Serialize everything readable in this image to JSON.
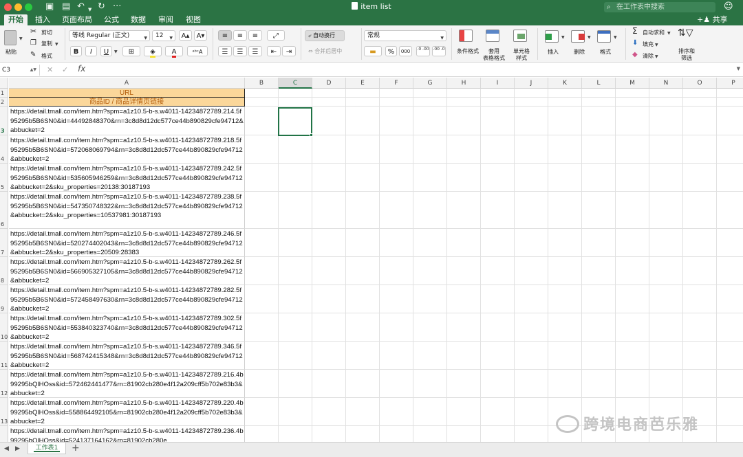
{
  "window": {
    "title": "item list",
    "search_placeholder": "在工作表中搜索"
  },
  "tabs": [
    "开始",
    "插入",
    "页面布局",
    "公式",
    "数据",
    "审阅",
    "视图"
  ],
  "share_label": "共享",
  "ribbon": {
    "paste": "粘贴",
    "cut": "剪切",
    "copy": "复制",
    "format_painter": "格式",
    "font_name": "等线 Regular (正文)",
    "font_size": "12",
    "bold": "B",
    "italic": "I",
    "underline": "U",
    "wrap_text": "自动换行",
    "merge_center": "合并后居中",
    "number_format": "常规",
    "percent": "%",
    "thousands": "000",
    "inc_decimal": ".0 .00",
    "dec_decimal": ".00 .0",
    "conditional_format": "条件格式",
    "table_format": "套用\n表格格式",
    "cell_style": "单元格\n样式",
    "insert": "插入",
    "delete": "删除",
    "format": "格式",
    "autosum": "自动求和",
    "fill": "填充",
    "clear": "清除",
    "sort_filter": "排序和\n筛选"
  },
  "formula_bar": {
    "name_box": "C3",
    "fx": "fx",
    "value": ""
  },
  "columns": [
    "A",
    "B",
    "C",
    "D",
    "E",
    "F",
    "G",
    "H",
    "I",
    "J",
    "K",
    "L",
    "M",
    "N",
    "O",
    "P"
  ],
  "selected_column": "C",
  "selected_row": "3",
  "rows": [
    {
      "num": "1",
      "text": "URL",
      "header": true
    },
    {
      "num": "2",
      "text": "商品ID / 商品详情页链接",
      "header": true
    },
    {
      "num": "3",
      "text": "https://detail.tmall.com/item.htm?spm=a1z10.5-b-s.w4011-14234872789.214.5f95295b5B6SN0&id=44492848370&rn=3c8d8d12dc577ce44b890829cfe94712&abbucket=2"
    },
    {
      "num": "4",
      "text": "https://detail.tmall.com/item.htm?spm=a1z10.5-b-s.w4011-14234872789.218.5f95295b5B6SN0&id=572068069794&rn=3c8d8d12dc577ce44b890829cfe94712&abbucket=2"
    },
    {
      "num": "5",
      "text": "https://detail.tmall.com/item.htm?spm=a1z10.5-b-s.w4011-14234872789.242.5f95295b5B6SN0&id=535605946259&rn=3c8d8d12dc577ce44b890829cfe94712&abbucket=2&sku_properties=20138:30187193"
    },
    {
      "num": "6",
      "text": "https://detail.tmall.com/item.htm?spm=a1z10.5-b-s.w4011-14234872789.238.5f95295b5B6SN0&id=547350748322&rn=3c8d8d12dc577ce44b890829cfe94712&abbucket=2&sku_properties=10537981:30187193"
    },
    {
      "num": "7",
      "text": "https://detail.tmall.com/item.htm?spm=a1z10.5-b-s.w4011-14234872789.246.5f95295b5B6SN0&id=520274402043&rn=3c8d8d12dc577ce44b890829cfe94712&abbucket=2&sku_properties=20509:28383"
    },
    {
      "num": "8",
      "text": "https://detail.tmall.com/item.htm?spm=a1z10.5-b-s.w4011-14234872789.262.5f95295b5B6SN0&id=566905327105&rn=3c8d8d12dc577ce44b890829cfe94712&abbucket=2"
    },
    {
      "num": "9",
      "text": "https://detail.tmall.com/item.htm?spm=a1z10.5-b-s.w4011-14234872789.282.5f95295b5B6SN0&id=572458497630&rn=3c8d8d12dc577ce44b890829cfe94712&abbucket=2"
    },
    {
      "num": "10",
      "text": "https://detail.tmall.com/item.htm?spm=a1z10.5-b-s.w4011-14234872789.302.5f95295b5B6SN0&id=553840323740&rn=3c8d8d12dc577ce44b890829cfe94712&abbucket=2"
    },
    {
      "num": "11",
      "text": "https://detail.tmall.com/item.htm?spm=a1z10.5-b-s.w4011-14234872789.346.5f95295b5B6SN0&id=568742415348&rn=3c8d8d12dc577ce44b890829cfe94712&abbucket=2"
    },
    {
      "num": "12",
      "text": "https://detail.tmall.com/item.htm?spm=a1z10.5-b-s.w4011-14234872789.216.4b99295bQlHOss&id=572462441477&rn=81902cb280e4f12a209cff5b702e83b3&abbucket=2"
    },
    {
      "num": "13",
      "text": "https://detail.tmall.com/item.htm?spm=a1z10.5-b-s.w4011-14234872789.220.4b99295bQlHOss&id=558864492105&rn=81902cb280e4f12a209cff5b702e83b3&abbucket=2"
    },
    {
      "num": "14",
      "text": "https://detail.tmall.com/item.htm?spm=a1z10.5-b-s.w4011-14234872789.236.4b99295bQlHOss&id=524137164162&rn=81902cb280e"
    }
  ],
  "sheet_tab": "工作表1",
  "watermark": "跨境电商芭乐雅",
  "colors": {
    "accent": "#217346",
    "titlebar": "#2b7344",
    "header_fill": "#fbd79a",
    "header_text": "#b45d0a"
  }
}
